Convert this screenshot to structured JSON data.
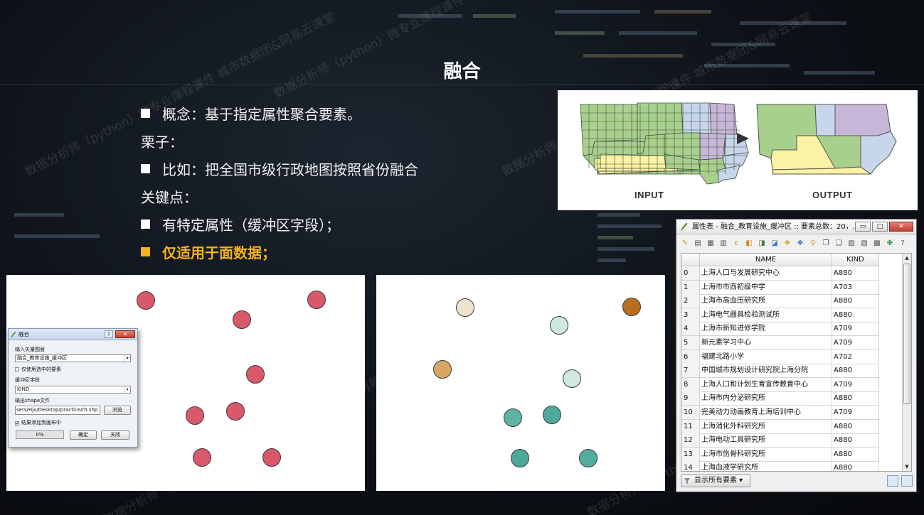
{
  "slide": {
    "title": "融合",
    "bullets": [
      {
        "text": "概念：基于指定属性聚合要素。",
        "marker": true,
        "highlight": false
      },
      {
        "text": "栗子：",
        "marker": false,
        "highlight": false
      },
      {
        "text": "比如：把全国市级行政地图按照省份融合",
        "marker": true,
        "highlight": false
      },
      {
        "text": "关键点：",
        "marker": false,
        "highlight": false
      },
      {
        "text": "有特定属性（缓冲区字段）；",
        "marker": true,
        "highlight": false
      },
      {
        "text": "仅适用于面数据；",
        "marker": true,
        "highlight": true
      }
    ],
    "watermark": "数据分析师（python）微专业课程课件  城市数据团&网易云课堂",
    "colors": {
      "highlight": "#f5b417",
      "before_point": "#d9596b"
    }
  },
  "iowa_figure": {
    "input_label": "INPUT",
    "output_label": "OUTPUT"
  },
  "dissolve_dialog": {
    "title": "融合",
    "help_button": "?",
    "close_button": "✕",
    "input_layer_label": "输入矢量图层",
    "input_layer_value": "融合_教育设施_缓冲区",
    "selected_only_label": "仅使用选中的要素",
    "selected_only_checked": false,
    "field_label": "缓冲区字段",
    "field_value": "KIND",
    "output_label": "输出shape文件",
    "output_value": "sers/Hjx/Desktop/practice/rh.shp",
    "browse_label": "浏览",
    "add_to_canvas_label": "结果添加到画布中",
    "add_to_canvas_checked": true,
    "progress": "0%",
    "ok_label": "确定",
    "close_label": "关闭"
  },
  "attribute_table": {
    "title": "属性表 - 融合_教育设施_缓冲区 :: 要素总数：20，...",
    "window_buttons": [
      "▭",
      "□",
      "✕"
    ],
    "columns": [
      "NAME",
      "KIND"
    ],
    "rows": [
      {
        "idx": "0",
        "name": "上海人口与发展研究中心",
        "kind": "A880"
      },
      {
        "idx": "1",
        "name": "上海市市西初级中学",
        "kind": "A703"
      },
      {
        "idx": "2",
        "name": "上海市高血压研究所",
        "kind": "A880"
      },
      {
        "idx": "3",
        "name": "上海电气器具检验测试所",
        "kind": "A880"
      },
      {
        "idx": "4",
        "name": "上海市新知进修学院",
        "kind": "A709"
      },
      {
        "idx": "5",
        "name": "新元素学习中心",
        "kind": "A709"
      },
      {
        "idx": "6",
        "name": "福建北路小学",
        "kind": "A702"
      },
      {
        "idx": "7",
        "name": "中国城市规划设计研究院上海分院",
        "kind": "A880"
      },
      {
        "idx": "8",
        "name": "上海人口和计划生育宣传教育中心",
        "kind": "A709"
      },
      {
        "idx": "9",
        "name": "上海市内分泌研究所",
        "kind": "A880"
      },
      {
        "idx": "10",
        "name": "完美动力动画教育上海培训中心",
        "kind": "A709"
      },
      {
        "idx": "11",
        "name": "上海消化外科研究所",
        "kind": "A880"
      },
      {
        "idx": "12",
        "name": "上海电动工具研究所",
        "kind": "A880"
      },
      {
        "idx": "13",
        "name": "上海市伤骨科研究所",
        "kind": "A880"
      },
      {
        "idx": "14",
        "name": "上海血液学研究所",
        "kind": "A880"
      }
    ],
    "footer_label": "显示所有要素"
  }
}
